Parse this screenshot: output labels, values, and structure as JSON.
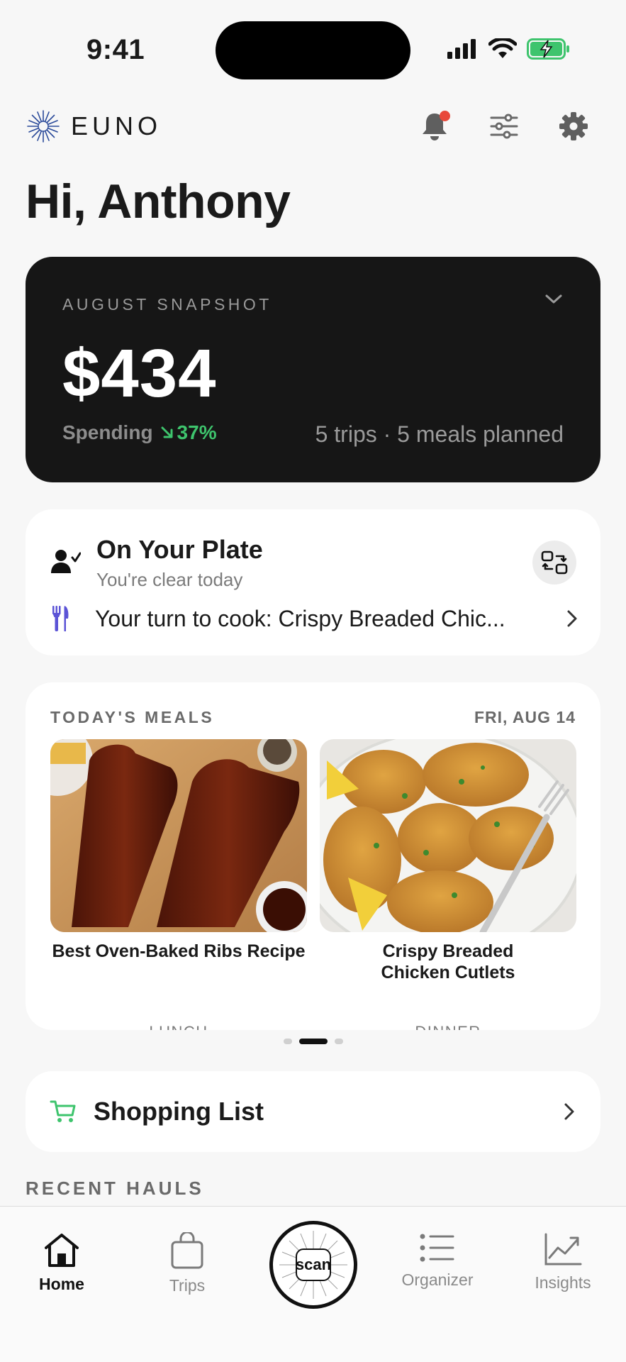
{
  "status_bar": {
    "time": "9:41"
  },
  "header": {
    "logo_text": "EUNO",
    "icons": [
      "bell-icon",
      "sliders-icon",
      "gear-icon"
    ]
  },
  "greeting": "Hi, Anthony",
  "snapshot": {
    "label": "AUGUST SNAPSHOT",
    "amount": "$434",
    "spending_label": "Spending",
    "spending_change": "37%",
    "meta": "5 trips · 5 meals planned"
  },
  "plate": {
    "title": "On Your Plate",
    "subtitle": "You're clear today",
    "cook_text": "Your turn to cook: Crispy Breaded Chic..."
  },
  "meals": {
    "label": "TODAY'S MEALS",
    "date": "FRI, AUG 14",
    "items": [
      {
        "name": "Best Oven-Baked Ribs Recipe",
        "type": "LUNCH"
      },
      {
        "name": "Crispy Breaded Chicken Cutlets",
        "type": "DINNER"
      }
    ],
    "pager": {
      "count": 3,
      "active": 1
    }
  },
  "shopping": {
    "label": "Shopping List"
  },
  "recent_hauls": {
    "label": "RECENT HAULS"
  },
  "tabbar": {
    "tabs": [
      {
        "label": "Home",
        "icon": "home-icon",
        "active": true
      },
      {
        "label": "Trips",
        "icon": "bag-icon",
        "active": false
      },
      {
        "label": "scan",
        "icon": "scan-icon",
        "active": false
      },
      {
        "label": "Organizer",
        "icon": "list-icon",
        "active": false
      },
      {
        "label": "Insights",
        "icon": "chart-icon",
        "active": false
      }
    ]
  },
  "colors": {
    "accent_green": "#3ec46d",
    "notification": "#e8483a",
    "cook_icon": "#5b53d6",
    "card_dark": "#161616"
  }
}
